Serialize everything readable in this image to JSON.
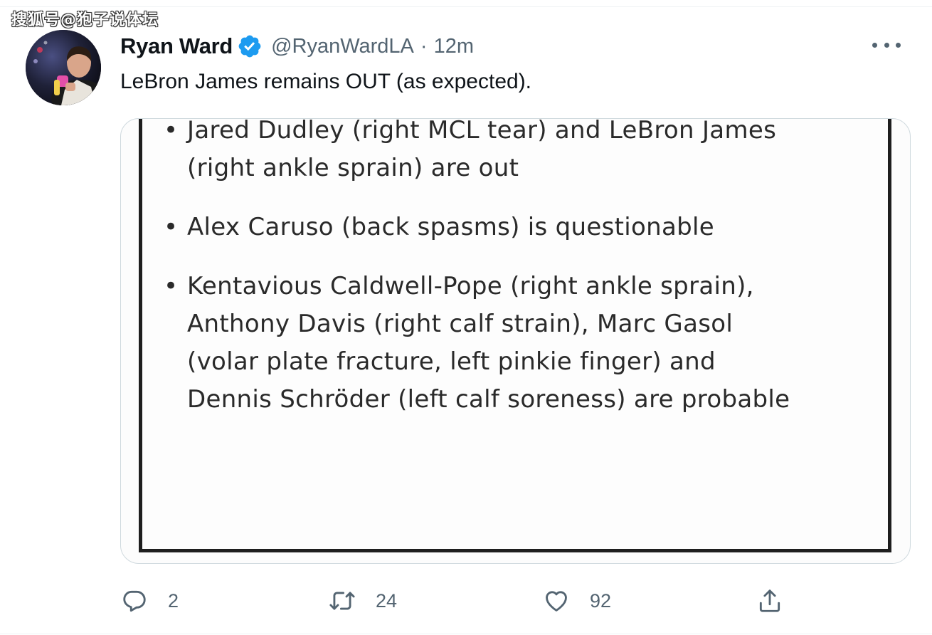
{
  "watermark": "搜狐号@狍子说体坛",
  "tweet": {
    "author": {
      "name": "Ryan Ward",
      "handle": "@RyanWardLA",
      "verified": true,
      "avatar_icon": "profile-photo"
    },
    "separator": "·",
    "timestamp": "12m",
    "text": "LeBron James remains OUT (as expected).",
    "media": {
      "items": [
        {
          "bullet": "•",
          "lines": [
            "Jared Dudley (right MCL tear) and LeBron James",
            "(right ankle sprain) are out"
          ]
        },
        {
          "bullet": "•",
          "lines": [
            "Alex Caruso (back spasms) is questionable"
          ]
        },
        {
          "bullet": "•",
          "lines": [
            "Kentavious Caldwell-Pope (right ankle sprain),",
            "Anthony Davis (right calf strain), Marc Gasol",
            "(volar plate fracture, left pinkie finger) and",
            "Dennis Schröder (left calf soreness) are probable"
          ]
        }
      ]
    },
    "actions": {
      "reply_count": "2",
      "retweet_count": "24",
      "like_count": "92"
    }
  },
  "colors": {
    "verified_blue": "#1d9bf0",
    "secondary_text": "#536471",
    "primary_text": "#0f1419",
    "card_border": "#cfd9de"
  }
}
